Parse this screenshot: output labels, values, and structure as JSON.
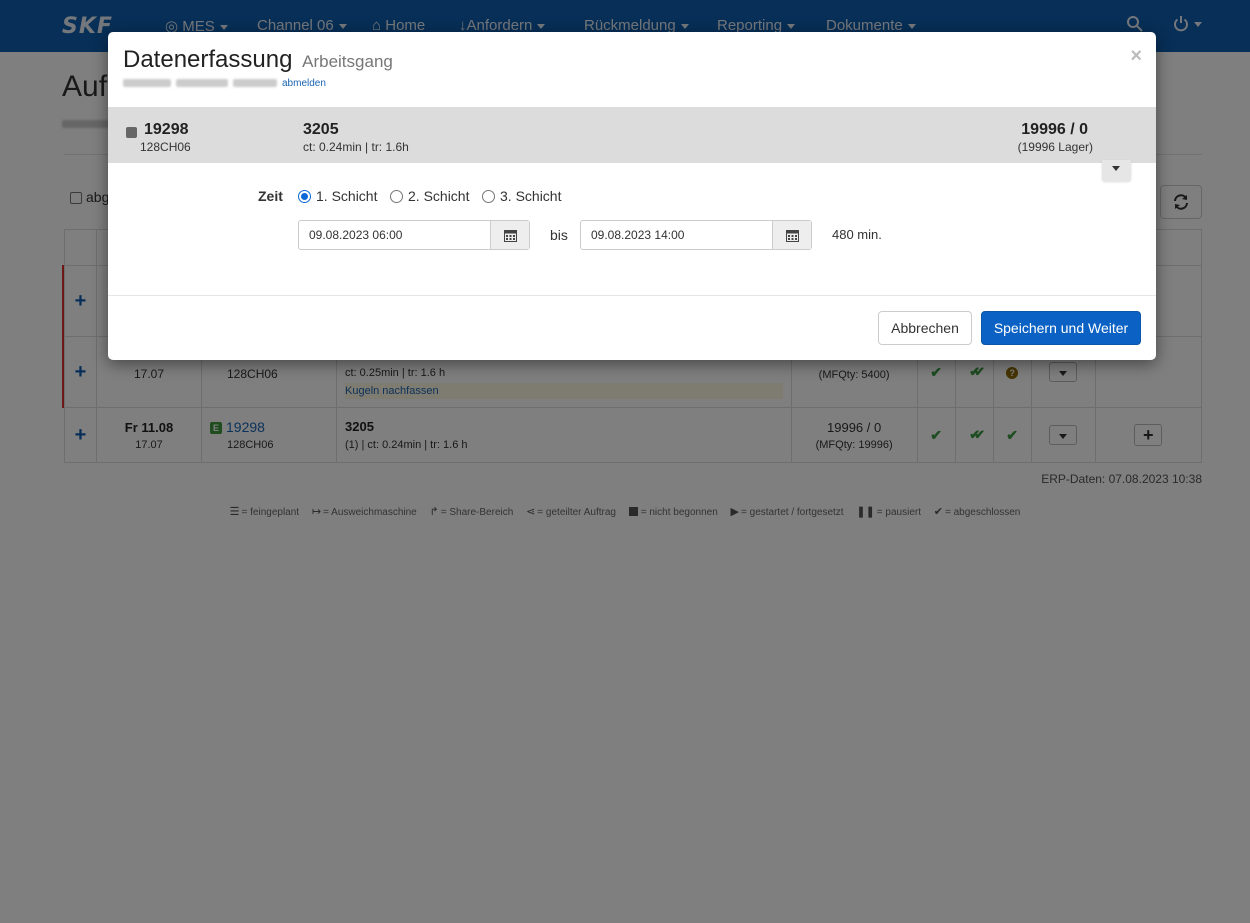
{
  "navbar": {
    "brand": "SKF",
    "mes_label": "MES",
    "channel_label": "Channel 06",
    "home_label": "Home",
    "request_label": "Anfordern",
    "feedback_label": "Rückmeldung",
    "reporting_label": "Reporting",
    "documents_label": "Dokumente"
  },
  "page": {
    "title_fragment": "Auf",
    "checkbox_fragment": "abg"
  },
  "orders": [
    {
      "date": "",
      "time": "17.07",
      "order_id": "",
      "machine": "128CH06",
      "operation": "",
      "details": "ct: 0.25min | tr: 1.6 h",
      "note": "Kugeln nachfassen",
      "qty": "",
      "mfqty": "(MFQty: 5400)"
    },
    {
      "date": "Fr 11.08",
      "time": "17.07",
      "badge": "E",
      "order_id": "19298",
      "machine": "128CH06",
      "operation": "3205",
      "details": "(1) | ct: 0.24min | tr: 1.6 h",
      "qty": "19996 / 0",
      "mfqty": "(MFQty: 19996)"
    }
  ],
  "erp_note": "ERP-Daten: 07.08.2023 10:38",
  "legend": {
    "planned": "= feingeplant",
    "alternate": "= Ausweichmaschine",
    "share": "= Share-Bereich",
    "split": "= geteilter Auftrag",
    "not_started": "= nicht begonnen",
    "started": "= gestartet / fortgesetzt",
    "paused": "= pausiert",
    "finished": "= abgeschlossen"
  },
  "modal": {
    "title": "Datenerfassung",
    "subtitle": "Arbeitsgang",
    "logout_link": "abmelden",
    "close": "×",
    "info": {
      "order_id": "19298",
      "machine": "128CH06",
      "operation": "3205",
      "times": "ct: 0.24min | tr: 1.6h",
      "qty": "19996 / 0",
      "store": "(19996 Lager)"
    },
    "zeit_label": "Zeit",
    "shifts": [
      "1. Schicht",
      "2. Schicht",
      "3. Schicht"
    ],
    "selected_shift": "1. Schicht",
    "from_value": "09.08.2023 06:00",
    "bis_label": "bis",
    "to_value": "09.08.2023 14:00",
    "minutes": "480 min.",
    "cancel_label": "Abbrechen",
    "save_label": "Speichern und Weiter"
  },
  "colors": {
    "navbar": "#0f5faf",
    "primary_button": "#0b62c4",
    "check_green": "#3c9a45",
    "alert_red": "#d9302c"
  }
}
